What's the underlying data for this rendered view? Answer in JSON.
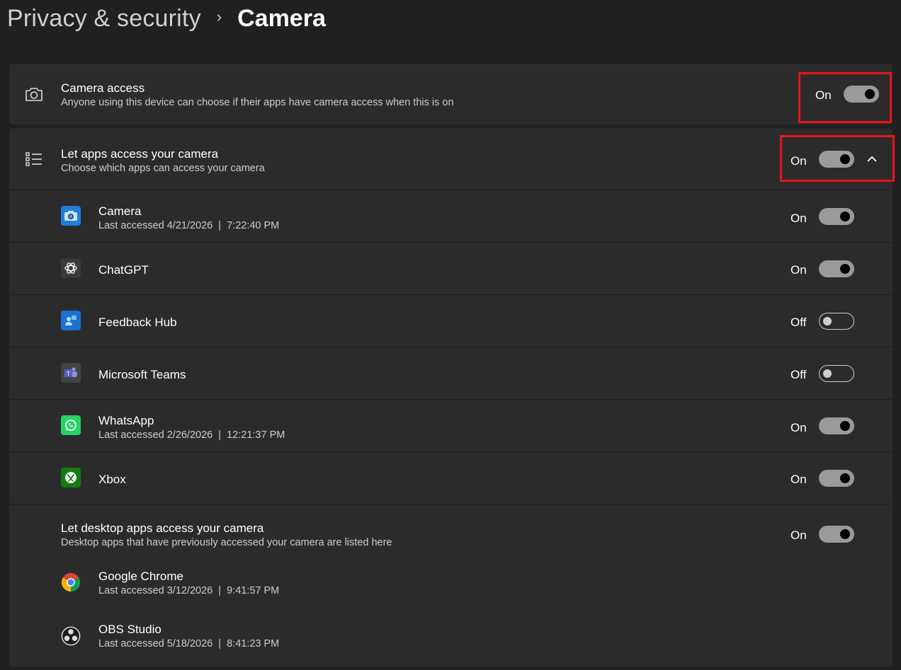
{
  "breadcrumb": {
    "parent": "Privacy & security",
    "separator": "›",
    "current": "Camera"
  },
  "camera_access": {
    "title": "Camera access",
    "subtitle": "Anyone using this device can choose if their apps have camera access when this is on",
    "state": "On",
    "icon": "camera-icon"
  },
  "let_apps": {
    "title": "Let apps access your camera",
    "subtitle": "Choose which apps can access your camera",
    "state": "On",
    "icon": "list-icon",
    "expand_icon": "chevron-up-icon"
  },
  "apps": [
    {
      "name": "Camera",
      "last_accessed": "Last accessed 4/21/2026  |  7:22:40 PM",
      "state": "On"
    },
    {
      "name": "ChatGPT",
      "last_accessed": "",
      "state": "On"
    },
    {
      "name": "Feedback Hub",
      "last_accessed": "",
      "state": "Off"
    },
    {
      "name": "Microsoft Teams",
      "last_accessed": "",
      "state": "Off"
    },
    {
      "name": "WhatsApp",
      "last_accessed": "Last accessed 2/26/2026  |  12:21:37 PM",
      "state": "On"
    },
    {
      "name": "Xbox",
      "last_accessed": "",
      "state": "On"
    }
  ],
  "desktop_apps": {
    "title": "Let desktop apps access your camera",
    "subtitle": "Desktop apps that have previously accessed your camera are listed here",
    "state": "On",
    "items": [
      {
        "name": "Google Chrome",
        "last_accessed": "Last accessed 3/12/2026  |  9:41:57 PM"
      },
      {
        "name": "OBS Studio",
        "last_accessed": "Last accessed 5/18/2026  |  8:41:23 PM"
      }
    ]
  },
  "colors": {
    "background": "#202020",
    "card": "#2b2b2b",
    "highlight": "#e8141b",
    "toggle_on": "#9a9a9a"
  }
}
